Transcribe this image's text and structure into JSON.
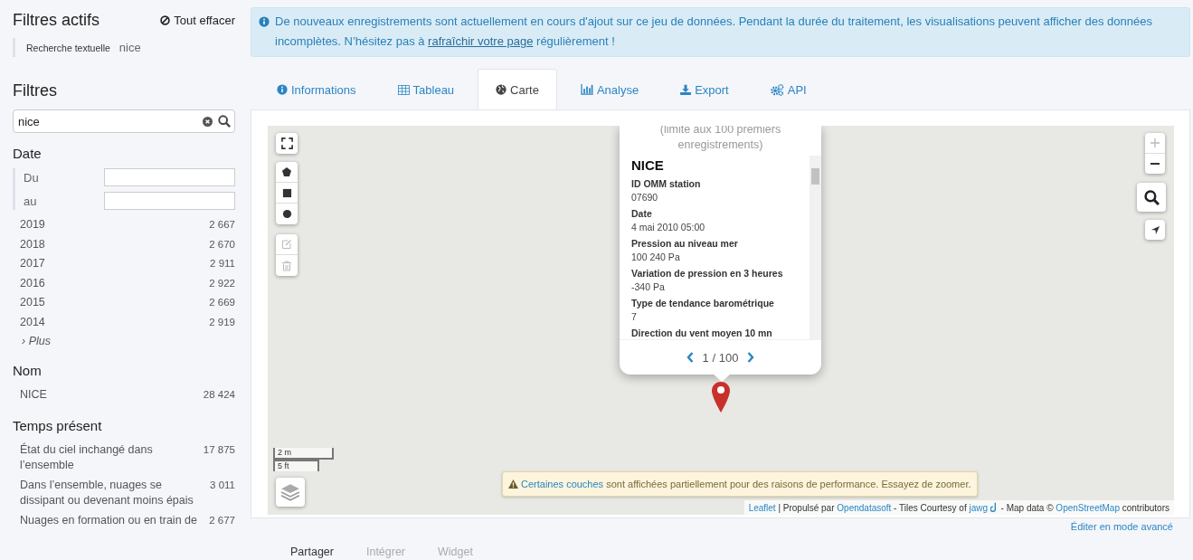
{
  "sidebar": {
    "active_filters": {
      "title": "Filtres actifs",
      "clear_label": "Tout effacer",
      "items": [
        {
          "label": "Recherche textuelle",
          "value": "nice"
        }
      ]
    },
    "filters_title": "Filtres",
    "search": {
      "value": "nice"
    },
    "facets": [
      {
        "title": "Date",
        "kind": "date",
        "range": [
          {
            "label": "Du"
          },
          {
            "label": "au"
          }
        ],
        "items": [
          {
            "label": "2019",
            "count": "2 667"
          },
          {
            "label": "2018",
            "count": "2 670"
          },
          {
            "label": "2017",
            "count": "2 911"
          },
          {
            "label": "2016",
            "count": "2 922"
          },
          {
            "label": "2015",
            "count": "2 669"
          },
          {
            "label": "2014",
            "count": "2 919"
          }
        ],
        "more": "› Plus"
      },
      {
        "title": "Nom",
        "kind": "list",
        "items": [
          {
            "label": "NICE",
            "count": "28 424"
          }
        ]
      },
      {
        "title": "Temps présent",
        "kind": "list",
        "items": [
          {
            "label": "État du ciel inchangé dans l’ensemble",
            "count": "17 875"
          },
          {
            "label": "Dans l’ensemble, nuages se dissipant ou devenant moins épais",
            "count": "3 011"
          },
          {
            "label": "Nuages en formation ou en train de",
            "count": "2 677"
          }
        ]
      }
    ]
  },
  "banner": {
    "text": "De nouveaux enregistrements sont actuellement en cours d'ajout sur ce jeu de données. Pendant la durée du traitement, les visualisations peuvent afficher des données incomplètes. N’hésitez pas à",
    "link": "rafraîchir votre page",
    "text_after": "régulièrement !"
  },
  "tabs": [
    {
      "label": "Informations",
      "selected": false
    },
    {
      "label": "Tableau",
      "selected": false
    },
    {
      "label": "Carte",
      "selected": true
    },
    {
      "label": "Analyse",
      "selected": false
    },
    {
      "label": "Export",
      "selected": false
    },
    {
      "label": "API",
      "selected": false
    }
  ],
  "map": {
    "popup": {
      "subtitle": "(limite aux 100 premiers enregistrements)",
      "title": "NICE",
      "fields": [
        {
          "label": "ID OMM station",
          "value": "07690"
        },
        {
          "label": "Date",
          "value": "4 mai 2010 05:00"
        },
        {
          "label": "Pression au niveau mer",
          "value": "100 240 Pa"
        },
        {
          "label": "Variation de pression en 3 heures",
          "value": "-340 Pa"
        },
        {
          "label": "Type de tendance barométrique",
          "value": "7"
        },
        {
          "label": "Direction du vent moyen 10 mn"
        }
      ],
      "pager": "1 / 100"
    },
    "scale": [
      "2 m",
      "5 ft"
    ],
    "notice": {
      "link": "Certaines couches",
      "text": "sont affichées partiellement pour des raisons de performance. Essayez de zoomer."
    },
    "attribution": [
      {
        "kind": "link",
        "text": "Leaflet"
      },
      {
        "kind": "text",
        "text": "| Propulsé par"
      },
      {
        "kind": "link",
        "text": "Opendatasoft"
      },
      {
        "kind": "text",
        "text": "- Tiles Courtesy of"
      },
      {
        "kind": "link",
        "text": "jawg"
      },
      {
        "kind": "icon"
      },
      {
        "kind": "text",
        "text": "- Map data ©"
      },
      {
        "kind": "link",
        "text": "OpenStreetMap"
      },
      {
        "kind": "text",
        "text": "contributors"
      }
    ]
  },
  "advanced_link": "Éditer en mode avancé",
  "share_tabs": [
    {
      "label": "Partager",
      "selected": true
    },
    {
      "label": "Intégrer",
      "selected": false
    },
    {
      "label": "Widget",
      "selected": false
    }
  ]
}
